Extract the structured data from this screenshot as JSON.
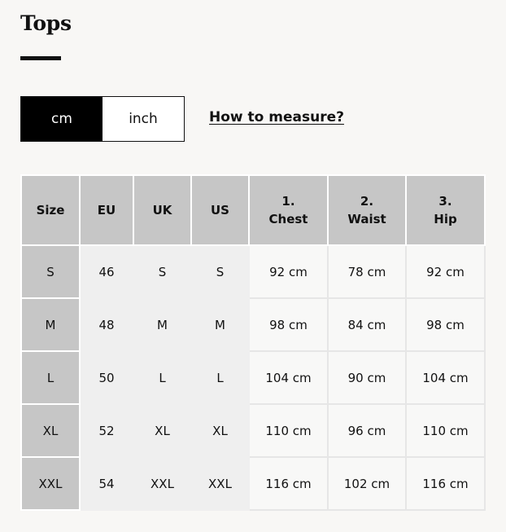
{
  "page": {
    "title": "Tops"
  },
  "units": {
    "cm_label": "cm",
    "inch_label": "inch",
    "selected": "cm"
  },
  "measure_link": "How to measure?",
  "table": {
    "headers": [
      {
        "num": "",
        "label": "Size"
      },
      {
        "num": "",
        "label": "EU"
      },
      {
        "num": "",
        "label": "UK"
      },
      {
        "num": "",
        "label": "US"
      },
      {
        "num": "1.",
        "label": "Chest"
      },
      {
        "num": "2.",
        "label": "Waist"
      },
      {
        "num": "3.",
        "label": "Hip"
      }
    ],
    "rows": [
      [
        "S",
        "46",
        "S",
        "S",
        "92 cm",
        "78 cm",
        "92 cm"
      ],
      [
        "M",
        "48",
        "M",
        "M",
        "98 cm",
        "84 cm",
        "98 cm"
      ],
      [
        "L",
        "50",
        "L",
        "L",
        "104 cm",
        "90 cm",
        "104 cm"
      ],
      [
        "XL",
        "52",
        "XL",
        "XL",
        "110 cm",
        "96 cm",
        "110 cm"
      ],
      [
        "XXL",
        "54",
        "XXL",
        "XXL",
        "116 cm",
        "102 cm",
        "116 cm"
      ]
    ]
  }
}
